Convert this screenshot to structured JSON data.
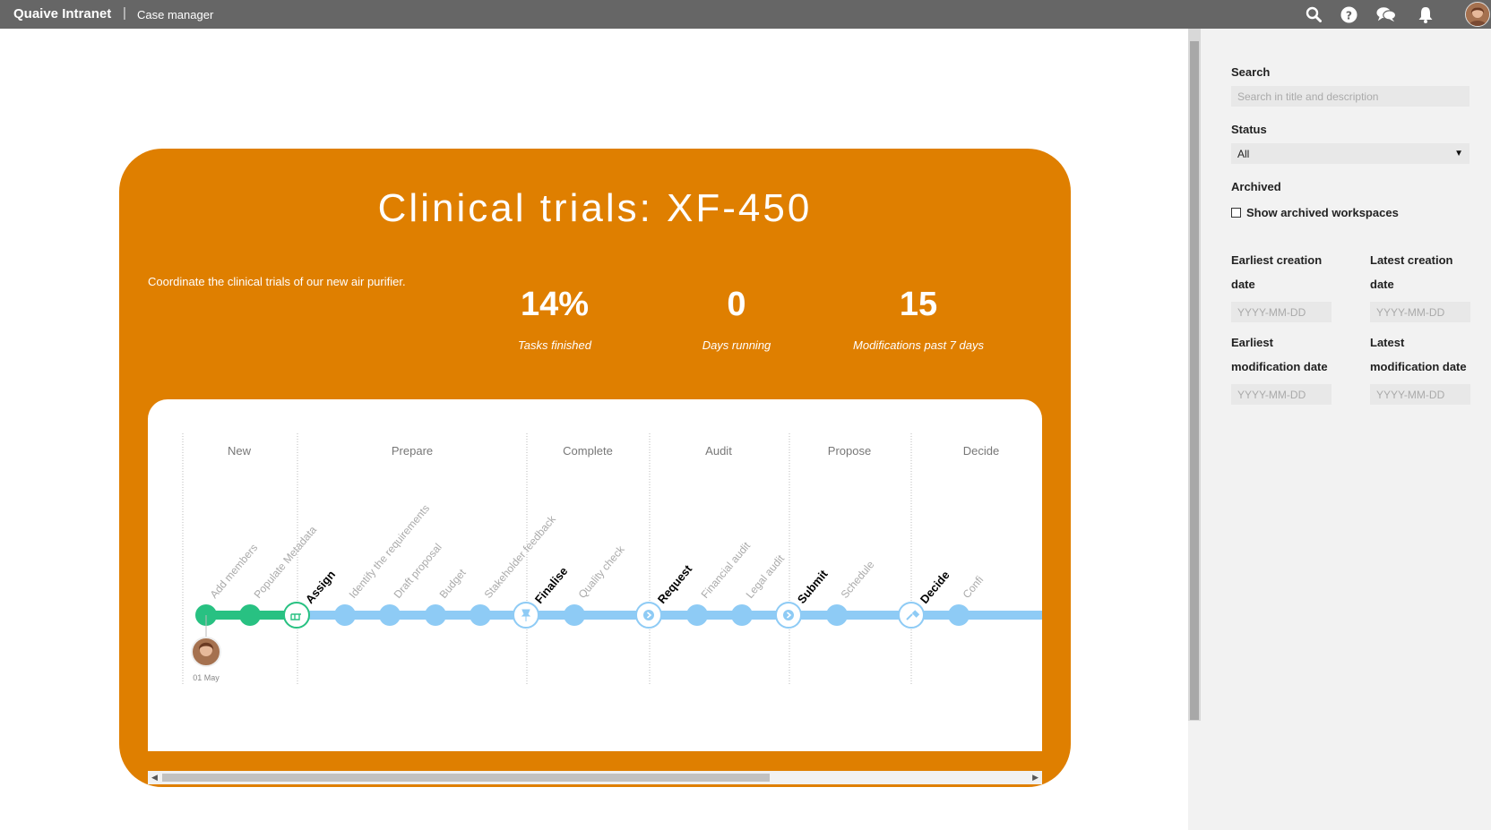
{
  "topbar": {
    "brand": "Quaive Intranet",
    "separator": "|",
    "app_name": "Case manager",
    "icons": [
      "search-icon",
      "help-icon",
      "chat-icon",
      "bell-icon",
      "user-avatar"
    ]
  },
  "workspace": {
    "title": "Clinical trials: XF-450",
    "description": "Coordinate the clinical trials of our new air purifier.",
    "stats": [
      {
        "value": "14%",
        "label": "Tasks finished"
      },
      {
        "value": "0",
        "label": "Days running"
      },
      {
        "value": "15",
        "label": "Modifications past 7 days"
      }
    ],
    "colors": {
      "panel": "#df7f00",
      "done": "#28c182",
      "todo": "#8ecbf5"
    }
  },
  "timeline": {
    "phases": [
      "New",
      "Prepare",
      "Complete",
      "Audit",
      "Propose",
      "Decide"
    ],
    "tasks": [
      {
        "label": "Add members",
        "milestone": false,
        "done": true
      },
      {
        "label": "Populate Metadata",
        "milestone": false,
        "done": true
      },
      {
        "label": "Assign",
        "milestone": true,
        "done": true,
        "icon": "hand-point-icon"
      },
      {
        "label": "Identify the requirements",
        "milestone": false,
        "done": false
      },
      {
        "label": "Draft proposal",
        "milestone": false,
        "done": false
      },
      {
        "label": "Budget",
        "milestone": false,
        "done": false
      },
      {
        "label": "Stakeholder feedback",
        "milestone": false,
        "done": false
      },
      {
        "label": "Finalise",
        "milestone": true,
        "done": false,
        "icon": "pin-icon"
      },
      {
        "label": "Quality check",
        "milestone": false,
        "done": false
      },
      {
        "label": "Request",
        "milestone": true,
        "done": false,
        "icon": "arrow-circle-icon"
      },
      {
        "label": "Financial audit",
        "milestone": false,
        "done": false
      },
      {
        "label": "Legal audit",
        "milestone": false,
        "done": false
      },
      {
        "label": "Submit",
        "milestone": true,
        "done": false,
        "icon": "arrow-circle-icon"
      },
      {
        "label": "Schedule",
        "milestone": false,
        "done": false
      },
      {
        "label": "Decide",
        "milestone": true,
        "done": false,
        "icon": "gavel-icon"
      },
      {
        "label": "Confi",
        "milestone": false,
        "done": false
      }
    ],
    "start_date": "01 May"
  },
  "sidebar": {
    "search": {
      "label": "Search",
      "placeholder": "Search in title and description"
    },
    "status": {
      "label": "Status",
      "value": "All"
    },
    "archived": {
      "label": "Archived",
      "checkbox_label": "Show archived workspaces"
    },
    "earliest_creation": {
      "label_line1": "Earliest creation",
      "label_line2": "date",
      "placeholder": "YYYY-MM-DD"
    },
    "latest_creation": {
      "label_line1": "Latest creation",
      "label_line2": "date",
      "placeholder": "YYYY-MM-DD"
    },
    "earliest_modification": {
      "label_line1": "Earliest",
      "label_line2": "modification date",
      "placeholder": "YYYY-MM-DD"
    },
    "latest_modification": {
      "label_line1": "Latest",
      "label_line2": "modification date",
      "placeholder": "YYYY-MM-DD"
    }
  }
}
